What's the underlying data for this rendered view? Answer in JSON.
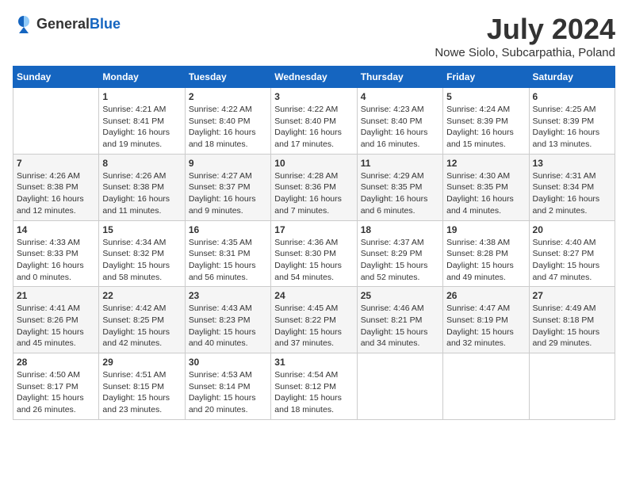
{
  "header": {
    "logo_general": "General",
    "logo_blue": "Blue",
    "month_year": "July 2024",
    "location": "Nowe Siolo, Subcarpathia, Poland"
  },
  "columns": [
    "Sunday",
    "Monday",
    "Tuesday",
    "Wednesday",
    "Thursday",
    "Friday",
    "Saturday"
  ],
  "weeks": [
    [
      {
        "day": "",
        "info": ""
      },
      {
        "day": "1",
        "info": "Sunrise: 4:21 AM\nSunset: 8:41 PM\nDaylight: 16 hours\nand 19 minutes."
      },
      {
        "day": "2",
        "info": "Sunrise: 4:22 AM\nSunset: 8:40 PM\nDaylight: 16 hours\nand 18 minutes."
      },
      {
        "day": "3",
        "info": "Sunrise: 4:22 AM\nSunset: 8:40 PM\nDaylight: 16 hours\nand 17 minutes."
      },
      {
        "day": "4",
        "info": "Sunrise: 4:23 AM\nSunset: 8:40 PM\nDaylight: 16 hours\nand 16 minutes."
      },
      {
        "day": "5",
        "info": "Sunrise: 4:24 AM\nSunset: 8:39 PM\nDaylight: 16 hours\nand 15 minutes."
      },
      {
        "day": "6",
        "info": "Sunrise: 4:25 AM\nSunset: 8:39 PM\nDaylight: 16 hours\nand 13 minutes."
      }
    ],
    [
      {
        "day": "7",
        "info": "Sunrise: 4:26 AM\nSunset: 8:38 PM\nDaylight: 16 hours\nand 12 minutes."
      },
      {
        "day": "8",
        "info": "Sunrise: 4:26 AM\nSunset: 8:38 PM\nDaylight: 16 hours\nand 11 minutes."
      },
      {
        "day": "9",
        "info": "Sunrise: 4:27 AM\nSunset: 8:37 PM\nDaylight: 16 hours\nand 9 minutes."
      },
      {
        "day": "10",
        "info": "Sunrise: 4:28 AM\nSunset: 8:36 PM\nDaylight: 16 hours\nand 7 minutes."
      },
      {
        "day": "11",
        "info": "Sunrise: 4:29 AM\nSunset: 8:35 PM\nDaylight: 16 hours\nand 6 minutes."
      },
      {
        "day": "12",
        "info": "Sunrise: 4:30 AM\nSunset: 8:35 PM\nDaylight: 16 hours\nand 4 minutes."
      },
      {
        "day": "13",
        "info": "Sunrise: 4:31 AM\nSunset: 8:34 PM\nDaylight: 16 hours\nand 2 minutes."
      }
    ],
    [
      {
        "day": "14",
        "info": "Sunrise: 4:33 AM\nSunset: 8:33 PM\nDaylight: 16 hours\nand 0 minutes."
      },
      {
        "day": "15",
        "info": "Sunrise: 4:34 AM\nSunset: 8:32 PM\nDaylight: 15 hours\nand 58 minutes."
      },
      {
        "day": "16",
        "info": "Sunrise: 4:35 AM\nSunset: 8:31 PM\nDaylight: 15 hours\nand 56 minutes."
      },
      {
        "day": "17",
        "info": "Sunrise: 4:36 AM\nSunset: 8:30 PM\nDaylight: 15 hours\nand 54 minutes."
      },
      {
        "day": "18",
        "info": "Sunrise: 4:37 AM\nSunset: 8:29 PM\nDaylight: 15 hours\nand 52 minutes."
      },
      {
        "day": "19",
        "info": "Sunrise: 4:38 AM\nSunset: 8:28 PM\nDaylight: 15 hours\nand 49 minutes."
      },
      {
        "day": "20",
        "info": "Sunrise: 4:40 AM\nSunset: 8:27 PM\nDaylight: 15 hours\nand 47 minutes."
      }
    ],
    [
      {
        "day": "21",
        "info": "Sunrise: 4:41 AM\nSunset: 8:26 PM\nDaylight: 15 hours\nand 45 minutes."
      },
      {
        "day": "22",
        "info": "Sunrise: 4:42 AM\nSunset: 8:25 PM\nDaylight: 15 hours\nand 42 minutes."
      },
      {
        "day": "23",
        "info": "Sunrise: 4:43 AM\nSunset: 8:23 PM\nDaylight: 15 hours\nand 40 minutes."
      },
      {
        "day": "24",
        "info": "Sunrise: 4:45 AM\nSunset: 8:22 PM\nDaylight: 15 hours\nand 37 minutes."
      },
      {
        "day": "25",
        "info": "Sunrise: 4:46 AM\nSunset: 8:21 PM\nDaylight: 15 hours\nand 34 minutes."
      },
      {
        "day": "26",
        "info": "Sunrise: 4:47 AM\nSunset: 8:19 PM\nDaylight: 15 hours\nand 32 minutes."
      },
      {
        "day": "27",
        "info": "Sunrise: 4:49 AM\nSunset: 8:18 PM\nDaylight: 15 hours\nand 29 minutes."
      }
    ],
    [
      {
        "day": "28",
        "info": "Sunrise: 4:50 AM\nSunset: 8:17 PM\nDaylight: 15 hours\nand 26 minutes."
      },
      {
        "day": "29",
        "info": "Sunrise: 4:51 AM\nSunset: 8:15 PM\nDaylight: 15 hours\nand 23 minutes."
      },
      {
        "day": "30",
        "info": "Sunrise: 4:53 AM\nSunset: 8:14 PM\nDaylight: 15 hours\nand 20 minutes."
      },
      {
        "day": "31",
        "info": "Sunrise: 4:54 AM\nSunset: 8:12 PM\nDaylight: 15 hours\nand 18 minutes."
      },
      {
        "day": "",
        "info": ""
      },
      {
        "day": "",
        "info": ""
      },
      {
        "day": "",
        "info": ""
      }
    ]
  ]
}
